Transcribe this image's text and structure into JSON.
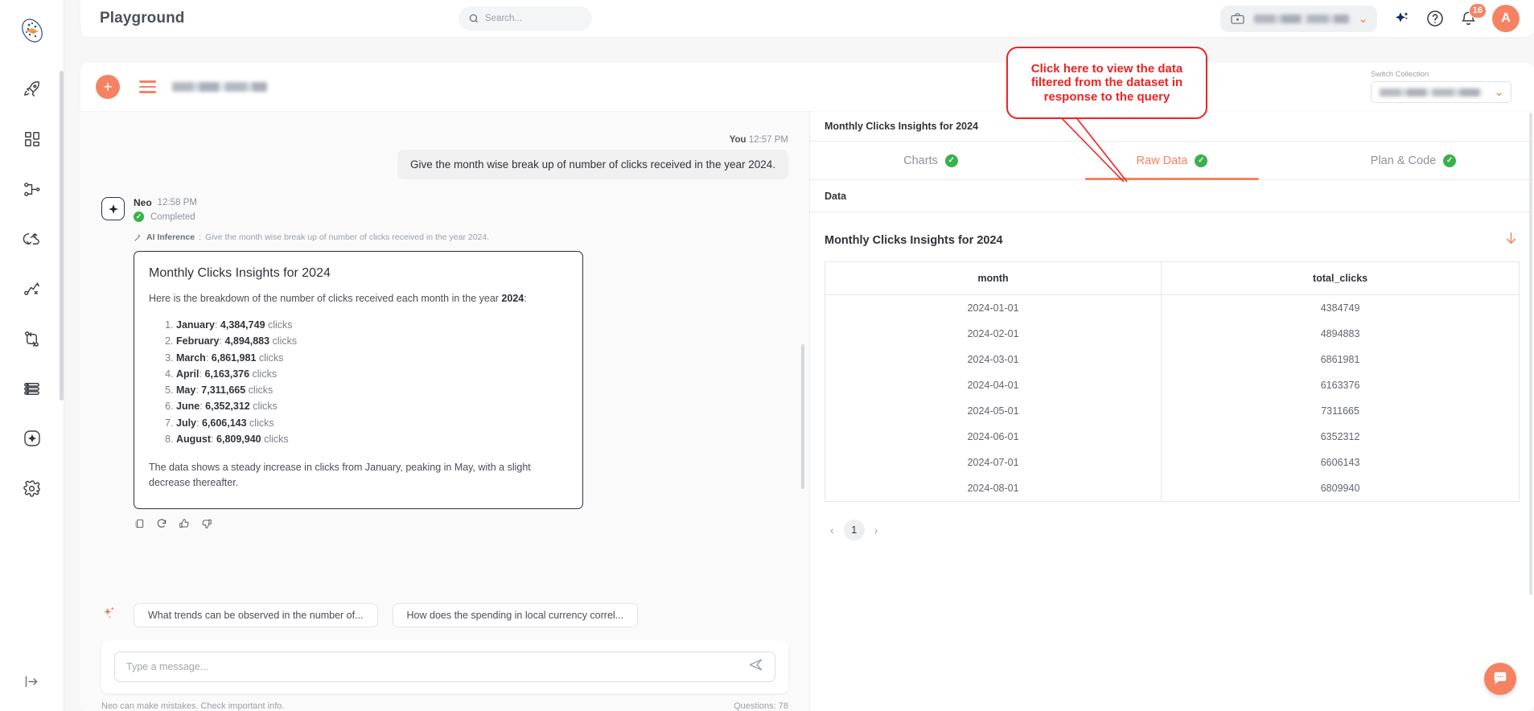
{
  "topbar": {
    "title": "Playground",
    "search": {
      "placeholder": "Search...",
      "value": ""
    },
    "workspace": {
      "icon": "briefcase-icon",
      "name_redacted": true
    },
    "notifications_count": "16",
    "avatar_initial": "A",
    "icons": [
      "sparkle-icon",
      "help-circle-icon",
      "bell-icon"
    ]
  },
  "chatbar": {
    "new_chat_label": "+",
    "thread_name_redacted": true,
    "switch_collection_label": "Switch Collection",
    "switch_collection_value_redacted": true
  },
  "sidebar": {
    "items": [
      {
        "name": "rocket-icon",
        "label": "Launch"
      },
      {
        "name": "dashboard-grid-icon",
        "label": "Dashboard"
      },
      {
        "name": "pipeline-icon",
        "label": "Pipelines"
      },
      {
        "name": "sync-cloud-icon",
        "label": "Sync"
      },
      {
        "name": "route-icon",
        "label": "Routes"
      },
      {
        "name": "branch-icon",
        "label": "Branches"
      },
      {
        "name": "database-icon",
        "label": "Data"
      },
      {
        "name": "ai-sparkle-icon",
        "label": "AI"
      },
      {
        "name": "gear-icon",
        "label": "Settings"
      }
    ],
    "collapse_label": "Expand"
  },
  "conversation": {
    "user": {
      "author": "You",
      "time": "12:57 PM",
      "text": "Give the month wise break up of number of clicks received in the year 2024."
    },
    "assistant": {
      "author": "Neo",
      "time": "12:58 PM",
      "status": "Completed",
      "inference_label": "AI Inference",
      "inference_separator": ":",
      "inference_text": "Give the month wise break up of number of clicks received in the year 2024.",
      "card": {
        "title": "Monthly Clicks Insights for 2024",
        "lead_before": "Here is the breakdown of the number of clicks received each month in the year ",
        "lead_bold": "2024",
        "lead_after": ":",
        "items": [
          {
            "month": "January",
            "value": "4,384,749",
            "unit": "clicks"
          },
          {
            "month": "February",
            "value": "4,894,883",
            "unit": "clicks"
          },
          {
            "month": "March",
            "value": "6,861,981",
            "unit": "clicks"
          },
          {
            "month": "April",
            "value": "6,163,376",
            "unit": "clicks"
          },
          {
            "month": "May",
            "value": "7,311,665",
            "unit": "clicks"
          },
          {
            "month": "June",
            "value": "6,352,312",
            "unit": "clicks"
          },
          {
            "month": "July",
            "value": "6,606,143",
            "unit": "clicks"
          },
          {
            "month": "August",
            "value": "6,809,940",
            "unit": "clicks"
          }
        ],
        "footer": "The data shows a steady increase in clicks from January, peaking in May, with a slight decrease thereafter."
      },
      "feedback_icons": [
        "copy-icon",
        "regenerate-icon",
        "thumbs-up-icon",
        "thumbs-down-icon"
      ]
    }
  },
  "suggestions": {
    "icon": "sparkle-icon",
    "chips": [
      "What trends can be observed in the number of...",
      "How does the spending in local currency correl..."
    ]
  },
  "composer": {
    "placeholder": "Type a message...",
    "value": "",
    "send_icon": "send-icon",
    "disclaimer": "Neo can make mistakes. Check important info.",
    "questions_counter": "Questions: 78"
  },
  "right_panel": {
    "header_title": "Monthly Clicks Insights for 2024",
    "tabs": [
      {
        "label": "Charts",
        "active": false,
        "status": "complete"
      },
      {
        "label": "Raw Data",
        "active": true,
        "status": "complete"
      },
      {
        "label": "Plan & Code",
        "active": false,
        "status": "complete"
      }
    ],
    "section_label": "Data",
    "result_title": "Monthly Clicks Insights for 2024",
    "download_icon": "download-arrow-icon",
    "pagination": {
      "prev": "‹",
      "current": "1",
      "next": "›"
    },
    "fab_icon": "chat-bubble-icon"
  },
  "chart_data": {
    "type": "table",
    "title": "Monthly Clicks Insights for 2024",
    "columns": [
      "month",
      "total_clicks"
    ],
    "rows": [
      [
        "2024-01-01",
        "4384749"
      ],
      [
        "2024-02-01",
        "4894883"
      ],
      [
        "2024-03-01",
        "6861981"
      ],
      [
        "2024-04-01",
        "6163376"
      ],
      [
        "2024-05-01",
        "7311665"
      ],
      [
        "2024-06-01",
        "6352312"
      ],
      [
        "2024-07-01",
        "6606143"
      ],
      [
        "2024-08-01",
        "6809940"
      ]
    ]
  },
  "annotation": {
    "text": "Click here to view the data filtered from the dataset in response to the query",
    "color": "#ef2222"
  },
  "colors": {
    "accent": "#f58362",
    "success": "#38b24a",
    "annotation": "#ef2222"
  }
}
